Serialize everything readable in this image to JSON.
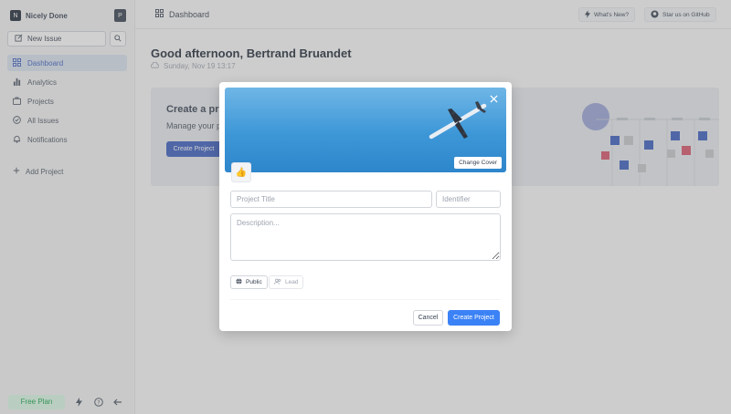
{
  "workspace": {
    "initial": "N",
    "name": "Nicely Done",
    "user_initial": "P"
  },
  "sidebar": {
    "new_issue_label": "New Issue",
    "items": [
      {
        "label": "Dashboard",
        "icon": "grid-icon",
        "active": true
      },
      {
        "label": "Analytics",
        "icon": "bar-chart-icon",
        "active": false
      },
      {
        "label": "Projects",
        "icon": "briefcase-icon",
        "active": false
      },
      {
        "label": "All Issues",
        "icon": "check-circle-icon",
        "active": false
      },
      {
        "label": "Notifications",
        "icon": "bell-icon",
        "active": false
      }
    ],
    "add_project_label": "Add Project",
    "free_plan_label": "Free Plan"
  },
  "header": {
    "title": "Dashboard",
    "whats_new_label": "What's New?",
    "github_label": "Star us on GitHub"
  },
  "main": {
    "greeting": "Good afternoon, Bertrand Bruandet",
    "date": "Sunday, Nov 19 13:17",
    "banner_title": "Create a pr",
    "banner_subtitle": "Manage your p",
    "banner_button": "Create Project"
  },
  "modal": {
    "change_cover_label": "Change Cover",
    "emoji": "👍",
    "title_placeholder": "Project Title",
    "identifier_placeholder": "Identifier",
    "description_placeholder": "Description...",
    "public_label": "Public",
    "lead_label": "Lead",
    "cancel_label": "Cancel",
    "create_label": "Create Project"
  },
  "colors": {
    "accent": "#3b82f6",
    "sidebar_active": "#dbe3f0",
    "free_plan_green": "#16a34a"
  }
}
